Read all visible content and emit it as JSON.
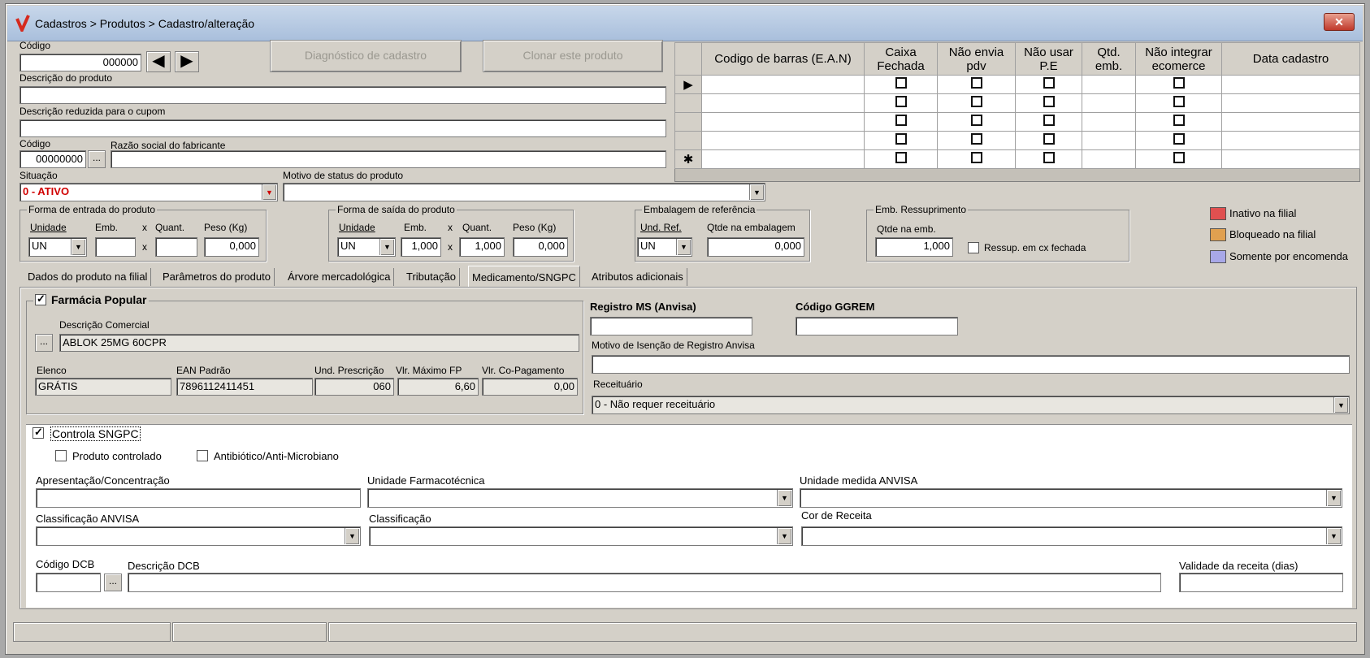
{
  "title": "Cadastros > Produtos > Cadastro/alteração",
  "codigo": {
    "label": "Código",
    "value": "000000"
  },
  "buttons": {
    "diagnostico": "Diagnóstico de cadastro",
    "clonar": "Clonar este produto",
    "prev": "◀",
    "next": "▶",
    "dots": "..."
  },
  "descricao": {
    "label": "Descrição  do produto",
    "value": ""
  },
  "descricao_reduzida": {
    "label": "Descrição reduzida para o cupom",
    "value": ""
  },
  "fabricante": {
    "codigo_label": "Código",
    "codigo_value": "00000000",
    "razao_label": "Razão social do fabricante",
    "razao_value": ""
  },
  "situacao": {
    "label": "Situação",
    "value": "0 - ATIVO",
    "color": "#d00000"
  },
  "motivo_status": {
    "label": "Motivo de status do produto",
    "value": ""
  },
  "forma_entrada": {
    "title": "Forma de entrada do produto",
    "unidade_label": "Unidade",
    "unidade": "UN",
    "emb_label": "Emb.",
    "x": "x",
    "quant_label": "Quant.",
    "peso_label": "Peso (Kg)",
    "emb": "",
    "quant": "",
    "peso": "0,000"
  },
  "forma_saida": {
    "title": "Forma de saída do produto",
    "unidade_label": "Unidade",
    "unidade": "UN",
    "emb_label": "Emb.",
    "x": "x",
    "quant_label": "Quant.",
    "peso_label": "Peso (Kg)",
    "emb": "1,000",
    "quant": "1,000",
    "peso": "0,000"
  },
  "embalagem_ref": {
    "title": "Embalagem de referência",
    "und_label": "Und. Ref.",
    "und": "UN",
    "qtde_label": "Qtde na embalagem",
    "qtde": "0,000"
  },
  "emb_ressup": {
    "title": "Emb. Ressuprimento",
    "qtde_label": "Qtde na emb.",
    "qtde": "1,000",
    "cb_label": "Ressup. em cx fechada"
  },
  "legend": [
    {
      "label": "Inativo na filial",
      "color": "#e05050"
    },
    {
      "label": "Bloqueado na filial",
      "color": "#e0a050"
    },
    {
      "label": "Somente por encomenda",
      "color": "#a8a8e8"
    }
  ],
  "grid": {
    "headers": [
      "Codigo de barras (E.A.N)",
      "Caixa Fechada",
      "Não envia pdv",
      "Não usar P.E",
      "Qtd. emb.",
      "Não integrar ecomerce",
      "Data cadastro"
    ],
    "row_markers": [
      "▶",
      "",
      "",
      "",
      "✱"
    ]
  },
  "tabs": [
    "Dados do produto na filial",
    "Parâmetros do produto",
    "Árvore mercadológica",
    "Tributação",
    "Medicamento/SNGPC",
    "Atributos adicionais"
  ],
  "farmacia": {
    "title": "Farmácia Popular",
    "desc_label": "Descrição Comercial",
    "desc_value": "ABLOK 25MG 60CPR",
    "elenco_label": "Elenco",
    "elenco": "GRÁTIS",
    "ean_label": "EAN Padrão",
    "ean": "7896112411451",
    "und_label": "Und. Prescrição",
    "und": "060",
    "vlr_max_label": "Vlr. Máximo FP",
    "vlr_max": "6,60",
    "vlr_co_label": "Vlr. Co-Pagamento",
    "vlr_co": "0,00"
  },
  "registro": {
    "ms_label": "Registro MS (Anvisa)",
    "ggrem_label": "Código GGREM",
    "motivo_label": "Motivo de Isenção de Registro Anvisa",
    "receituario_label": "Receituário",
    "receituario": "0 - Não requer receituário"
  },
  "sngpc": {
    "title": "Controla SNGPC",
    "controlado": "Produto controlado",
    "antibiotico": "Antibiótico/Anti-Microbiano",
    "apresentacao": "Apresentação/Concentração",
    "unidade_farm": "Unidade Farmacotécnica",
    "unidade_anvisa": "Unidade medida ANVISA",
    "class_anvisa": "Classificação ANVISA",
    "classificacao": "Classificação",
    "cor_receita": "Cor de  Receita",
    "codigo_dcb": "Código DCB",
    "descricao_dcb": "Descrição DCB",
    "validade": "Validade da receita (dias)"
  }
}
